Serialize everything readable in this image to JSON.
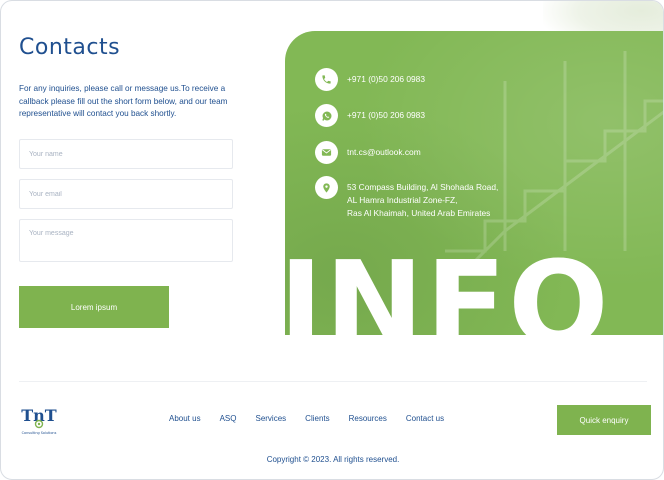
{
  "contact": {
    "title": "Contacts",
    "intro": "For any inquiries, please call or message us.To receive a callback please fill out the short form below, and our team representative will contact you back shortly.",
    "form": {
      "name_placeholder": "Your name",
      "email_placeholder": "Your email",
      "message_placeholder": "Your message",
      "submit_label": "Lorem ipsum"
    }
  },
  "info": {
    "big_word": "INFO",
    "phone": "+971 (0)50 206 0983",
    "whatsapp": "+971 (0)50 206 0983",
    "email": "tnt.cs@outlook.com",
    "address_lines": [
      "53 Compass Building, Al Shohada Road,",
      "AL Hamra Industrial Zone-FZ,",
      "Ras Al Khaimah, United Arab Emirates"
    ]
  },
  "footer": {
    "logo_text": "TnT",
    "logo_subtext": "Consulting Solutions",
    "nav": [
      "About us",
      "ASQ",
      "Services",
      "Clients",
      "Resources",
      "Contact us"
    ],
    "quick_enquiry_label": "Quick enquiry",
    "copyright": "Copyright © 2023. All rights reserved."
  },
  "colors": {
    "brand_blue": "#1f4f8f",
    "brand_green": "#7fb34f"
  },
  "icons": {
    "phone": "phone-icon",
    "whatsapp": "whatsapp-icon",
    "email": "mail-icon",
    "address": "location-pin-icon"
  }
}
